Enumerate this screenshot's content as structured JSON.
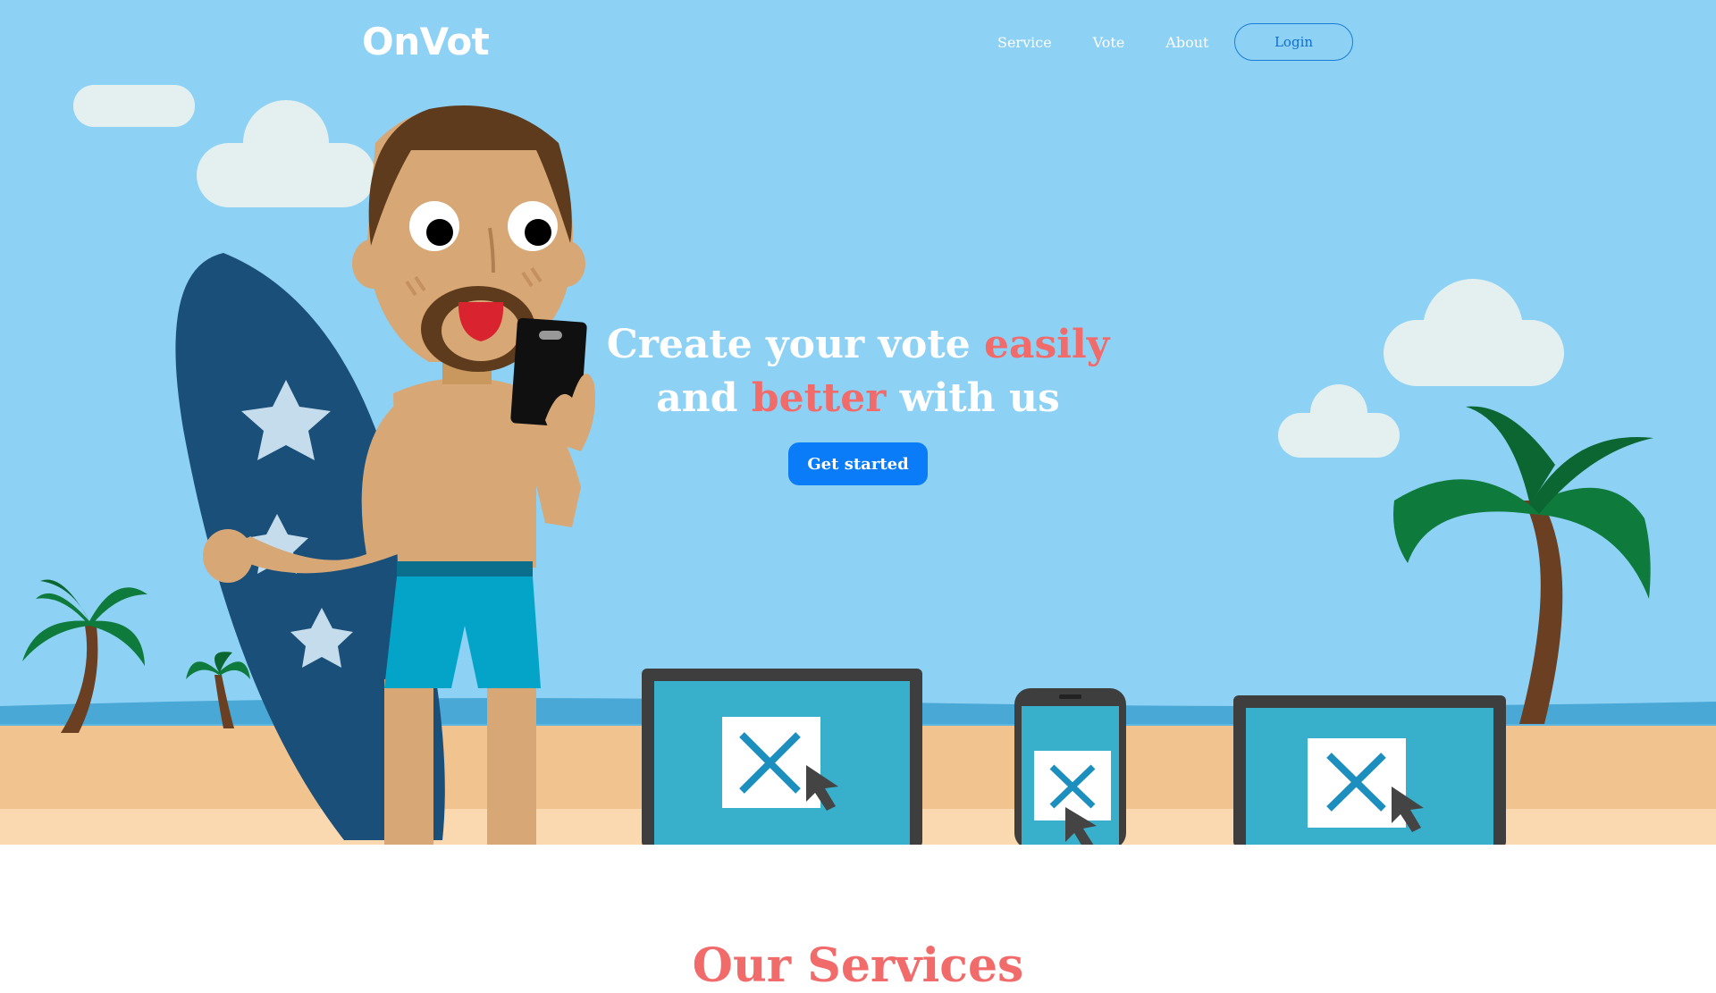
{
  "brand": {
    "name": "OnVot"
  },
  "nav": {
    "items": [
      {
        "label": "Service"
      },
      {
        "label": "Vote"
      },
      {
        "label": "About"
      }
    ],
    "login_label": "Login"
  },
  "hero": {
    "headline_part1": "Create your vote ",
    "headline_highlight1": "easily",
    "headline_part2": "and ",
    "headline_highlight2": "better",
    "headline_part3": " with us",
    "cta_label": "Get started",
    "illustration": "beach-scene-illustration"
  },
  "services": {
    "title": "Our Services"
  },
  "colors": {
    "sky": "#8dd1f5",
    "accent_red": "#f26b6b",
    "primary_blue": "#0a7cf7",
    "sand": "#f1c38f"
  }
}
